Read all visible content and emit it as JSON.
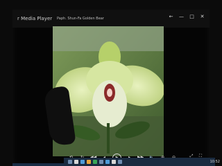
{
  "window": {
    "app_title": "r Media Player",
    "file_name": "Paph. Shun-Fa Golden Bear"
  },
  "controls": {
    "shuffle": "⟲",
    "repeat": "↻",
    "prev": "◀◀",
    "back": "◂",
    "play": "▶",
    "forward": "▸",
    "next": "▶▶",
    "volume": "🔈",
    "zoom_in": "⊕",
    "zoom_out": "⊖"
  },
  "window_controls": {
    "back": "←",
    "min": "—",
    "max": "□",
    "close": "✕"
  },
  "tray": {
    "text": "10:52"
  },
  "colors": {
    "accent": "#1a2b40"
  }
}
